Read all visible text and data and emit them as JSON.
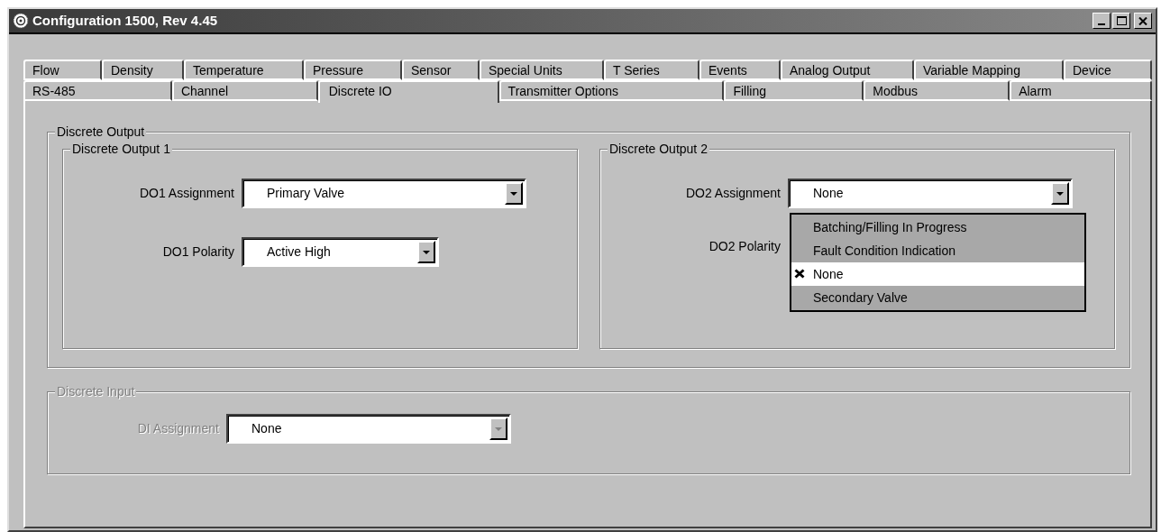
{
  "window": {
    "title": "Configuration 1500, Rev 4.45"
  },
  "tab_rows": [
    [
      {
        "label": "Flow",
        "selected": false
      },
      {
        "label": "Density",
        "selected": false
      },
      {
        "label": "Temperature",
        "selected": false
      },
      {
        "label": "Pressure",
        "selected": false
      },
      {
        "label": "Sensor",
        "selected": false
      },
      {
        "label": "Special Units",
        "selected": false
      },
      {
        "label": "T Series",
        "selected": false
      },
      {
        "label": "Events",
        "selected": false
      },
      {
        "label": "Analog Output",
        "selected": false
      },
      {
        "label": "Variable Mapping",
        "selected": false
      },
      {
        "label": "Device",
        "selected": false
      }
    ],
    [
      {
        "label": "RS-485",
        "selected": false
      },
      {
        "label": "Channel",
        "selected": false
      },
      {
        "label": "Discrete IO",
        "selected": true
      },
      {
        "label": "Transmitter Options",
        "selected": false
      },
      {
        "label": "Filling",
        "selected": false
      },
      {
        "label": "Modbus",
        "selected": false
      },
      {
        "label": "Alarm",
        "selected": false
      }
    ]
  ],
  "discrete_output": {
    "title": "Discrete Output",
    "disabled": false,
    "outputs": [
      {
        "title": "Discrete Output 1",
        "assignment": {
          "label": "DO1 Assignment",
          "value": "Primary Valve"
        },
        "polarity": {
          "label": "DO1 Polarity",
          "value": "Active High"
        }
      },
      {
        "title": "Discrete Output 2",
        "assignment": {
          "label": "DO2 Assignment",
          "value": "None",
          "expanded": true,
          "options": [
            {
              "label": "Batching/Filling In Progress",
              "selected": false
            },
            {
              "label": "Fault Condition Indication",
              "selected": false
            },
            {
              "label": "None",
              "selected": true
            },
            {
              "label": "Secondary Valve",
              "selected": false
            }
          ]
        },
        "polarity": {
          "label": "DO2 Polarity"
        }
      }
    ]
  },
  "discrete_input": {
    "title": "Discrete Input",
    "disabled": true,
    "assignment": {
      "label": "DI Assignment",
      "value": "None"
    }
  }
}
